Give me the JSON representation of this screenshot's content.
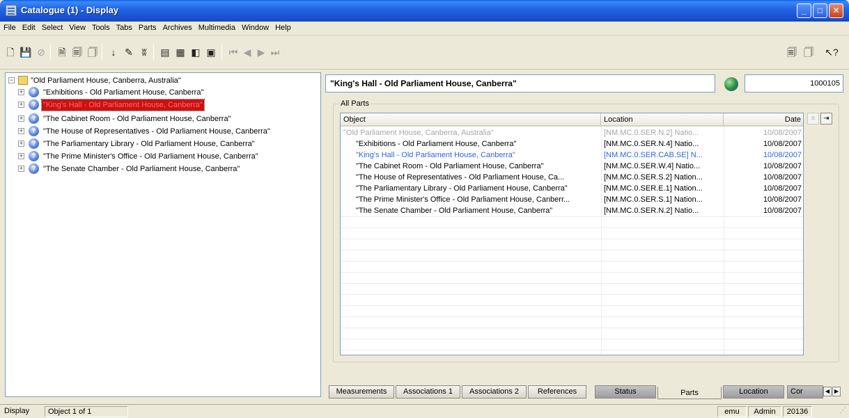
{
  "window": {
    "title": "Catalogue (1) - Display",
    "minimize": "_",
    "maximize": "□",
    "close": "✕"
  },
  "menu": [
    "File",
    "Edit",
    "Select",
    "View",
    "Tools",
    "Tabs",
    "Parts",
    "Archives",
    "Multimedia",
    "Window",
    "Help"
  ],
  "toolbar": {
    "icons": [
      "new-icon",
      "save-icon",
      "cancel-icon",
      "record-icon",
      "record-add-icon",
      "record-delete-icon",
      "sort-icon",
      "edit-icon",
      "spellcheck-icon",
      "view-list-icon",
      "view-detail-icon",
      "view-page-icon",
      "view-form-icon",
      "first-icon",
      "prev-icon",
      "next-icon",
      "last-icon",
      "copy-icon",
      "paste-icon",
      "help-icon"
    ],
    "glyphs": [
      "🗋",
      "💾",
      "⊘",
      "🗎",
      "🗐",
      "🗍",
      "↓",
      "✎",
      "ʬ",
      "▤",
      "▦",
      "◧",
      "▣",
      "⏮",
      "◀",
      "▶",
      "⏭",
      "🗐",
      "🗍",
      "↖?"
    ]
  },
  "tree": {
    "root": "\"Old Parliament House, Canberra, Australia\"",
    "children": [
      "\"Exhibitions - Old Parliament House, Canberra\"",
      "\"King's Hall - Old Parliament House, Canberra\"",
      "\"The Cabinet Room - Old Parliament House, Canberra\"",
      "\"The House of Representatives - Old Parliament House, Canberra\"",
      "\"The Parliamentary Library - Old Parliament House, Canberra\"",
      "\"The Prime Minister's Office - Old Parliament House, Canberra\"",
      "\"The Senate Chamber - Old Parliament House, Canberra\""
    ],
    "node_glyph": "?",
    "expander_plus": "+",
    "expander_minus": "−"
  },
  "record": {
    "title": "\"King's Hall - Old Parliament House, Canberra\"",
    "irn": "1000105"
  },
  "parts": {
    "group_label": "All Parts",
    "columns": [
      "Object",
      "Location",
      "Date"
    ],
    "rows": [
      {
        "object": "\"Old Parliament House, Canberra, Australia\"",
        "location": "[NM.MC.0.SER.N.2] Natio...",
        "date": "10/08/2007",
        "style": "grey"
      },
      {
        "object": "\"Exhibitions - Old Parliament House, Canberra\"",
        "location": "[NM.MC.0.SER.N.4] Natio...",
        "date": "10/08/2007",
        "style": "normal"
      },
      {
        "object": "\"King's Hall - Old Parliament House, Canberra\"",
        "location": "[NM.MC.0.SER.CAB.SE] N...",
        "date": "10/08/2007",
        "style": "blue"
      },
      {
        "object": "\"The Cabinet Room - Old Parliament House, Canberra\"",
        "location": "[NM.MC.0.SER.W.4] Natio...",
        "date": "10/08/2007",
        "style": "normal"
      },
      {
        "object": "\"The House of Representatives - Old Parliament House, Ca...",
        "location": "[NM.MC.0.SER.S.2] Nation...",
        "date": "10/08/2007",
        "style": "normal"
      },
      {
        "object": "\"The Parliamentary Library - Old Parliament House, Canberra\"",
        "location": "[NM.MC.0.SER.E.1] Nation...",
        "date": "10/08/2007",
        "style": "normal"
      },
      {
        "object": "\"The Prime Minister's Office - Old Parliament House, Canberr...",
        "location": "[NM.MC.0.SER.S.1] Nation...",
        "date": "10/08/2007",
        "style": "normal"
      },
      {
        "object": "\"The Senate Chamber - Old Parliament House, Canberra\"",
        "location": "[NM.MC.0.SER.N.2] Natio...",
        "date": "10/08/2007",
        "style": "normal"
      }
    ],
    "side_buttons": [
      "≡",
      "⇥"
    ]
  },
  "tabs": [
    {
      "label": "Measurements",
      "style": "normal"
    },
    {
      "label": "Associations 1",
      "style": "normal"
    },
    {
      "label": "Associations 2",
      "style": "normal"
    },
    {
      "label": "References",
      "style": "normal"
    },
    {
      "label": "Status",
      "style": "dark"
    },
    {
      "label": "Parts",
      "style": "active"
    },
    {
      "label": "Location",
      "style": "dark"
    },
    {
      "label": "Cor",
      "style": "dark"
    }
  ],
  "tab_scroll": [
    "◀",
    "▶"
  ],
  "status": {
    "mode": "Display",
    "position": "Object 1 of 1",
    "user": "emu",
    "role": "Admin",
    "port": "20136",
    "grip": "⋰"
  },
  "colors": {
    "titlebar": "#1a56d8",
    "selected_bg": "#cc1111",
    "selected_fg": "#ff6a6a",
    "current_row": "#2f63e8",
    "grey_row": "#a6a6a6"
  }
}
